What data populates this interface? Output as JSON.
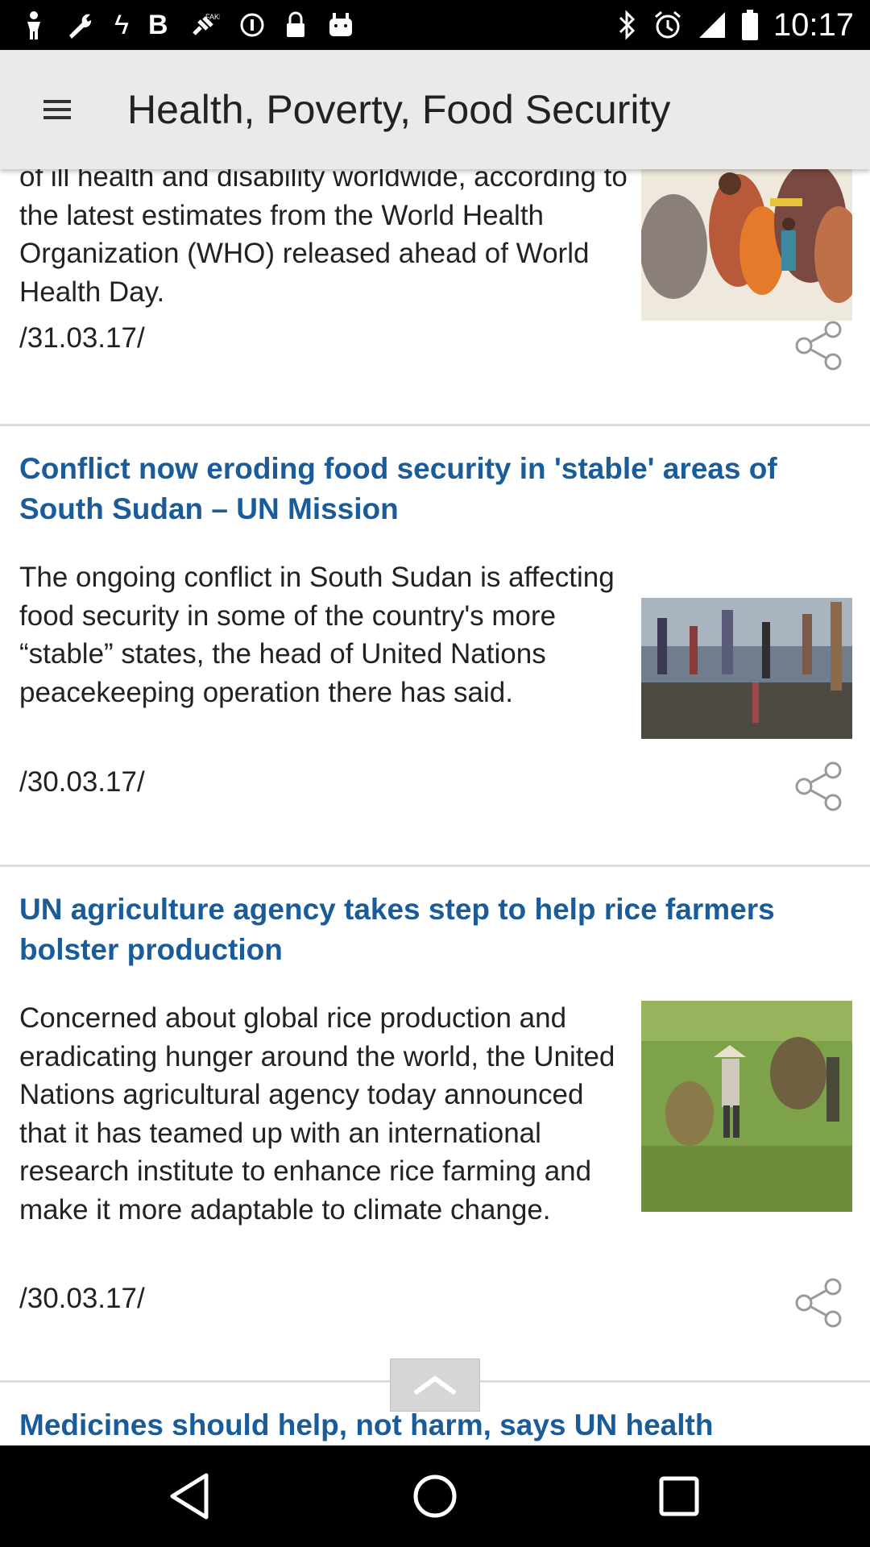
{
  "status_bar": {
    "time": "10:17",
    "left_icons": [
      "person-icon",
      "wrench-icon",
      "five-icon",
      "bold-b-icon",
      "satellite-icon",
      "circle-pause-icon",
      "lock-icon",
      "android-icon"
    ],
    "right_icons": [
      "bluetooth-icon",
      "alarm-icon",
      "signal-icon",
      "battery-icon"
    ]
  },
  "app_bar": {
    "title": "Health, Poverty, Food Security",
    "menu_icon": "hamburger-menu-icon"
  },
  "articles": [
    {
      "title": "",
      "text": "of ill health and disability worldwide, according to the latest estimates from the World Health Organization (WHO) released ahead of World Health Day.",
      "date": "/31.03.17/",
      "image": "crowd-colorful-clothing-photo"
    },
    {
      "title": "Conflict now eroding food security in 'stable' areas of South Sudan – UN Mission",
      "text": "The ongoing conflict in South Sudan is affecting food security in some of the country's more “stable” states, the head of United Nations peacekeeping operation there has said.",
      "date": "/30.03.17/",
      "image": "people-walking-muddy-camp-photo"
    },
    {
      "title": "UN agriculture agency takes step to help rice farmers bolster production",
      "text": "Concerned about global rice production and eradicating hunger around the world, the United Nations agricultural agency today announced that it has teamed up with an international research institute to enhance rice farming and make it more adaptable to climate change.",
      "date": "/30.03.17/",
      "image": "farmer-carrying-rice-field-photo"
    },
    {
      "title": "Medicines should help, not harm, says UN health",
      "text": "",
      "date": "",
      "image": ""
    }
  ],
  "colors": {
    "title_blue": "#1a5c99",
    "app_bar_bg": "#eaeaea",
    "divider": "#dcdcdc"
  },
  "nav": [
    "back-icon",
    "home-icon",
    "recents-icon"
  ]
}
